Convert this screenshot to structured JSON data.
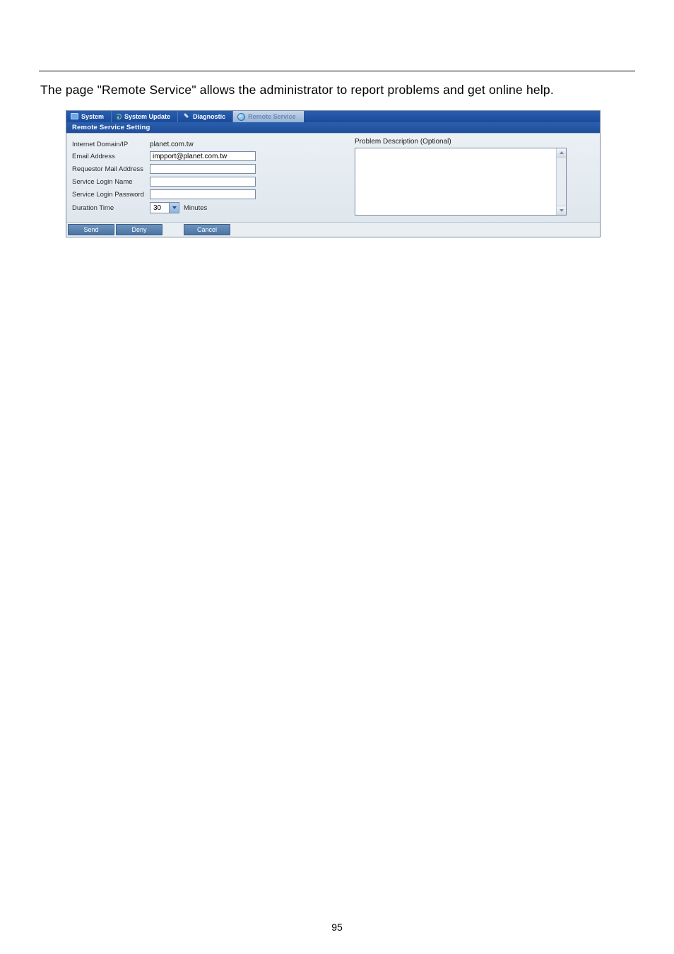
{
  "intro_text": "The page \"Remote Service\" allows the administrator to report problems and get online help.",
  "tabs": {
    "system": "System",
    "system_update": "System Update",
    "diagnostic": "Diagnostic",
    "remote_service": "Remote Service"
  },
  "section_title": "Remote Service Setting",
  "form": {
    "internet_domain_ip": {
      "label": "Internet Domain/IP",
      "value": "planet.com.tw"
    },
    "email_address": {
      "label": "Email Address",
      "value": "impport@planet.com.tw"
    },
    "requestor_mail": {
      "label": "Requestor Mail Address",
      "value": ""
    },
    "service_login_name": {
      "label": "Service Login Name",
      "value": ""
    },
    "service_login_pw": {
      "label": "Service Login Password",
      "value": ""
    },
    "duration_time": {
      "label": "Duration Time",
      "value": "30",
      "unit": "Minutes"
    }
  },
  "right": {
    "title": "Problem Description (Optional)",
    "value": ""
  },
  "buttons": {
    "send": "Send",
    "deny": "Deny",
    "cancel": "Cancel"
  },
  "page_number": "95"
}
